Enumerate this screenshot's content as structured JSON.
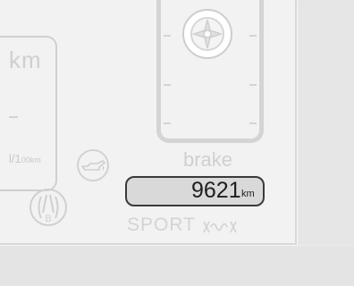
{
  "left_gauge": {
    "unit": "km",
    "consumption_unit_main": "l/1",
    "consumption_unit_small": "00km"
  },
  "icons": {
    "oil": "oil-can-icon",
    "parking_brake": "parking-brake-icon",
    "brake_wheel": "brake-wheel-icon",
    "sport_spring": "sport-spring-icon"
  },
  "brake_gauge": {
    "label": "brake"
  },
  "odometer": {
    "value": "9621",
    "unit": "km"
  },
  "mode": {
    "label": "SPORT"
  },
  "colors": {
    "panel": "#f2f2f2",
    "faint_text": "#d0d0d0",
    "odometer_border": "#3a3a3a"
  }
}
